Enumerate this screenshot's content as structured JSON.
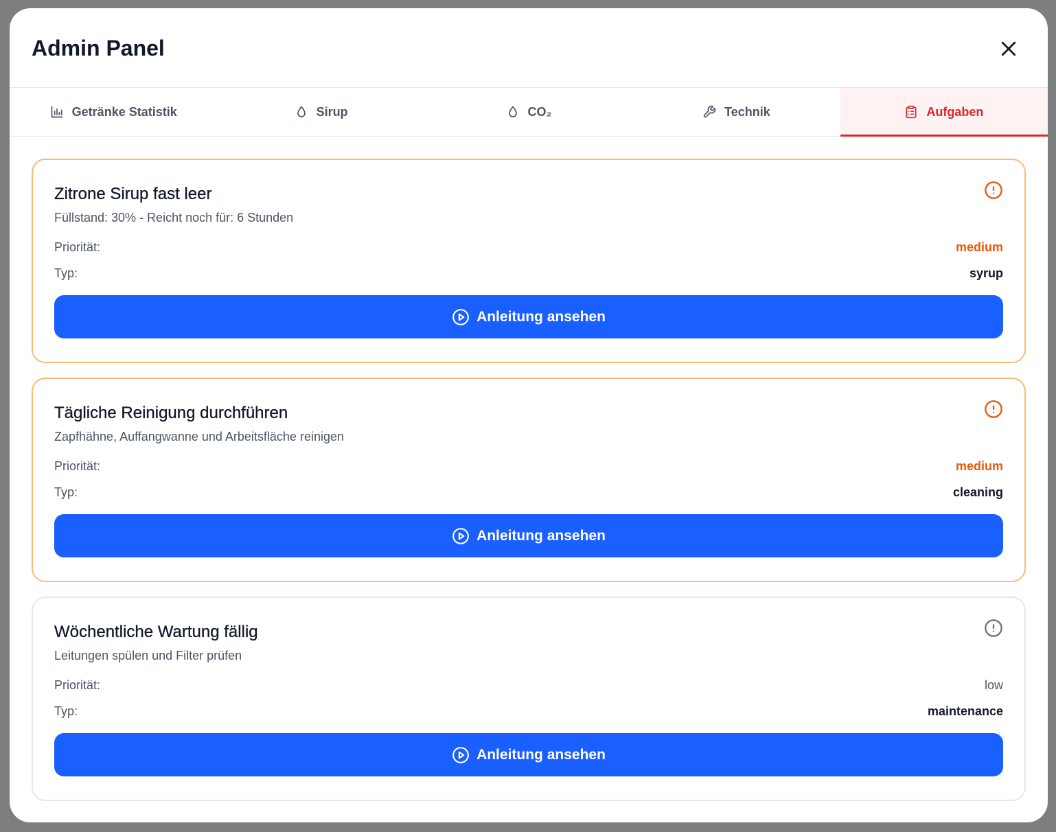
{
  "header": {
    "title": "Admin Panel"
  },
  "tabs": [
    {
      "label": "Getränke Statistik",
      "icon": "bar-chart-icon"
    },
    {
      "label": "Sirup",
      "icon": "droplet-icon"
    },
    {
      "label": "CO₂",
      "icon": "droplet-icon"
    },
    {
      "label": "Technik",
      "icon": "wrench-icon"
    },
    {
      "label": "Aufgaben",
      "icon": "clipboard-list-icon",
      "active": true
    }
  ],
  "labels": {
    "priority": "Priorität:",
    "type": "Typ:",
    "button": "Anleitung ansehen"
  },
  "tasks": [
    {
      "title": "Zitrone Sirup fast leer",
      "description": "Füllstand: 30% - Reicht noch für: 6 Stunden",
      "priority": "medium",
      "type": "syrup"
    },
    {
      "title": "Tägliche Reinigung durchführen",
      "description": "Zapfhähne, Auffangwanne und Arbeitsfläche reinigen",
      "priority": "medium",
      "type": "cleaning"
    },
    {
      "title": "Wöchentliche Wartung fällig",
      "description": "Leitungen spülen und Filter prüfen",
      "priority": "low",
      "type": "maintenance"
    }
  ],
  "colors": {
    "accent": "#dc2626",
    "button": "#1a5fff",
    "medium": "#ea580c",
    "low": "#4b5563"
  }
}
